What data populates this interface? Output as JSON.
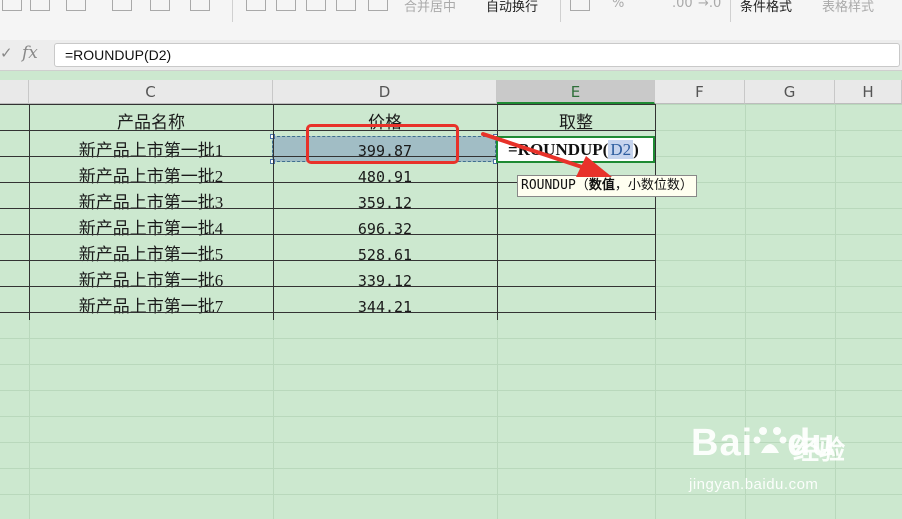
{
  "toolbar": {
    "merge_center": "合并居中",
    "wrap_text": "自动换行",
    "conditional_format": "条件格式",
    "table_style": "表格样式",
    "percent": "%",
    "decimal_more": ".00",
    "decimal_less": "→.0"
  },
  "formula_bar": {
    "check_symbol": "✓",
    "fx_label": "fx",
    "value": "=ROUNDUP(D2)"
  },
  "column_headers": [
    "C",
    "D",
    "E",
    "F",
    "G",
    "H"
  ],
  "table": {
    "headers": {
      "name": "产品名称",
      "price": "价格",
      "rounded": "取整"
    },
    "rows": [
      {
        "name": "新产品上市第一批1",
        "price": "399.87"
      },
      {
        "name": "新产品上市第一批2",
        "price": "480.91"
      },
      {
        "name": "新产品上市第一批3",
        "price": "359.12"
      },
      {
        "name": "新产品上市第一批4",
        "price": "696.32"
      },
      {
        "name": "新产品上市第一批5",
        "price": "528.61"
      },
      {
        "name": "新产品上市第一批6",
        "price": "339.12"
      },
      {
        "name": "新产品上市第一批7",
        "price": "344.21"
      }
    ]
  },
  "edit_cell": {
    "prefix": "=ROUNDUP(",
    "ref": "D2",
    "suffix": ")"
  },
  "tooltip": {
    "func": "ROUNDUP",
    "open": "（",
    "arg1": "数值",
    "sep": "，",
    "arg2": "小数位数",
    "close": "）"
  },
  "watermark": {
    "brand": "Bai",
    "brand2": "du",
    "product": "经验",
    "url": "jingyan.baidu.com"
  },
  "colors": {
    "sheet_background": "#cce8cf",
    "selection_fill": "#a1bdc5",
    "active_cell_border": "#1e8a33",
    "annotation_red": "#e8322a"
  }
}
